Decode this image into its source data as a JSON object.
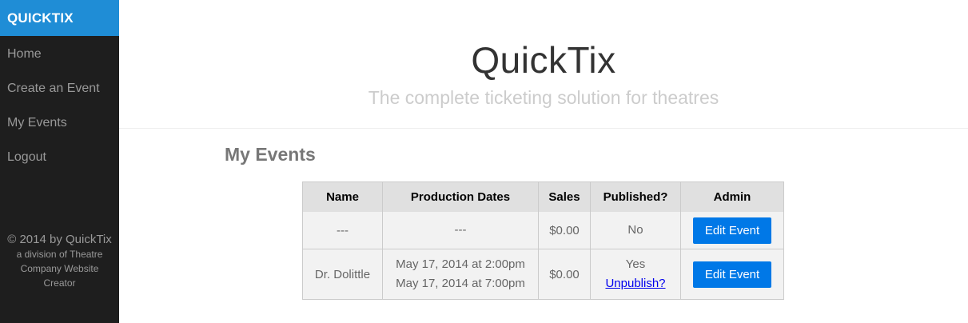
{
  "sidebar": {
    "brand": "QUICKTIX",
    "nav": [
      {
        "label": "Home"
      },
      {
        "label": "Create an Event"
      },
      {
        "label": "My Events"
      },
      {
        "label": "Logout"
      }
    ],
    "footer": {
      "copyright": "© 2014 by QuickTix",
      "subtitle": "a division of Theatre Company Website Creator"
    }
  },
  "header": {
    "title": "QuickTix",
    "subtitle": "The complete ticketing solution for theatres"
  },
  "main": {
    "section_title": "My Events",
    "table": {
      "columns": [
        "Name",
        "Production Dates",
        "Sales",
        "Published?",
        "Admin"
      ],
      "rows": [
        {
          "name": "---",
          "dates": [
            "---"
          ],
          "sales": "$0.00",
          "published": "No",
          "unpublish_link": "",
          "admin_button": "Edit Event"
        },
        {
          "name": "Dr. Dolittle",
          "dates": [
            "May 17, 2014 at 2:00pm",
            "May 17, 2014 at 7:00pm"
          ],
          "sales": "$0.00",
          "published": "Yes",
          "unpublish_link": "Unpublish?",
          "admin_button": "Edit Event"
        }
      ]
    }
  },
  "colors": {
    "brand_bg": "#1f8dd6",
    "sidebar_bg": "#1e1e1e",
    "button_bg": "#0078e7",
    "link": "#0000ee"
  }
}
